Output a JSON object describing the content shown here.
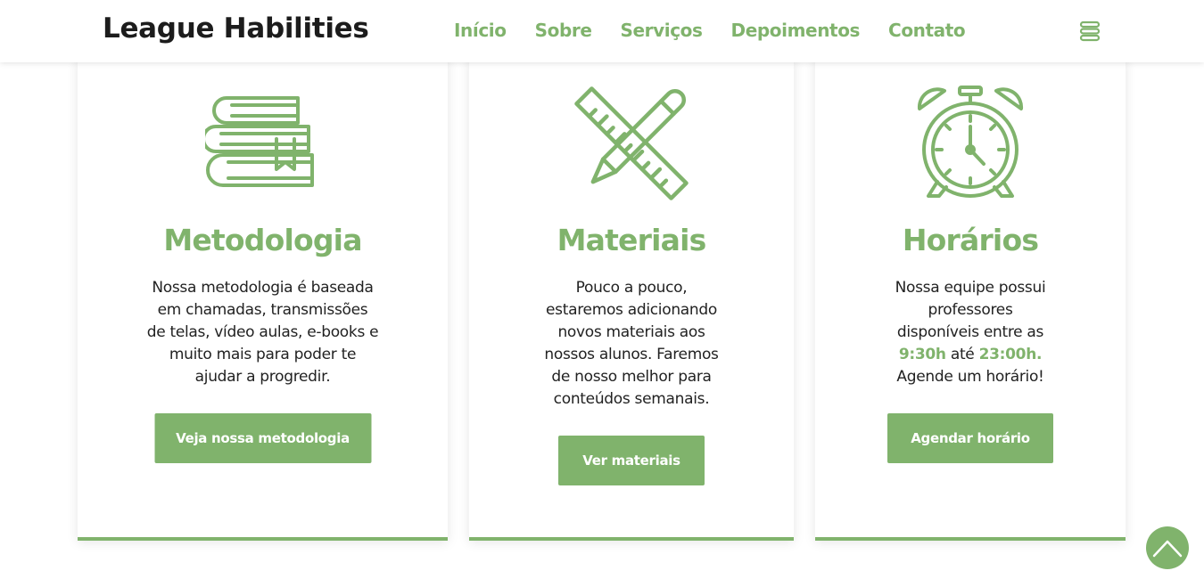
{
  "header": {
    "logo": "League Habilities",
    "nav": [
      "Início",
      "Sobre",
      "Serviços",
      "Depoimentos",
      "Contato"
    ],
    "menu_icon": "menu-stack-icon"
  },
  "colors": {
    "accent": "#80b36c",
    "text": "#222222"
  },
  "cards": [
    {
      "icon": "books-icon",
      "title": "Metodologia",
      "lines": [
        "Nossa metodologia é baseada",
        "em chamadas, transmissões",
        "de telas, vídeo aulas, e-books e",
        "muito mais para poder te",
        "ajudar a progredir."
      ],
      "button": "Veja nossa metodologia"
    },
    {
      "icon": "ruler-pencil-icon",
      "title": "Materiais",
      "lines": [
        "Pouco a pouco,",
        "estaremos adicionando",
        "novos materiais aos",
        "nossos alunos. Faremos",
        "de nosso melhor para",
        "conteúdos semanais."
      ],
      "button": "Ver materiais"
    },
    {
      "icon": "alarm-clock-icon",
      "title": "Horários",
      "lines": [
        "Nossa equipe possui",
        "professores",
        "disponíveis entre as"
      ],
      "time_start": "9:30h",
      "time_mid": " até ",
      "time_end": "23:00h.",
      "last_line": "Agende um horário!",
      "button": "Agendar horário"
    }
  ],
  "scroll_top_icon": "chevron-up-icon"
}
